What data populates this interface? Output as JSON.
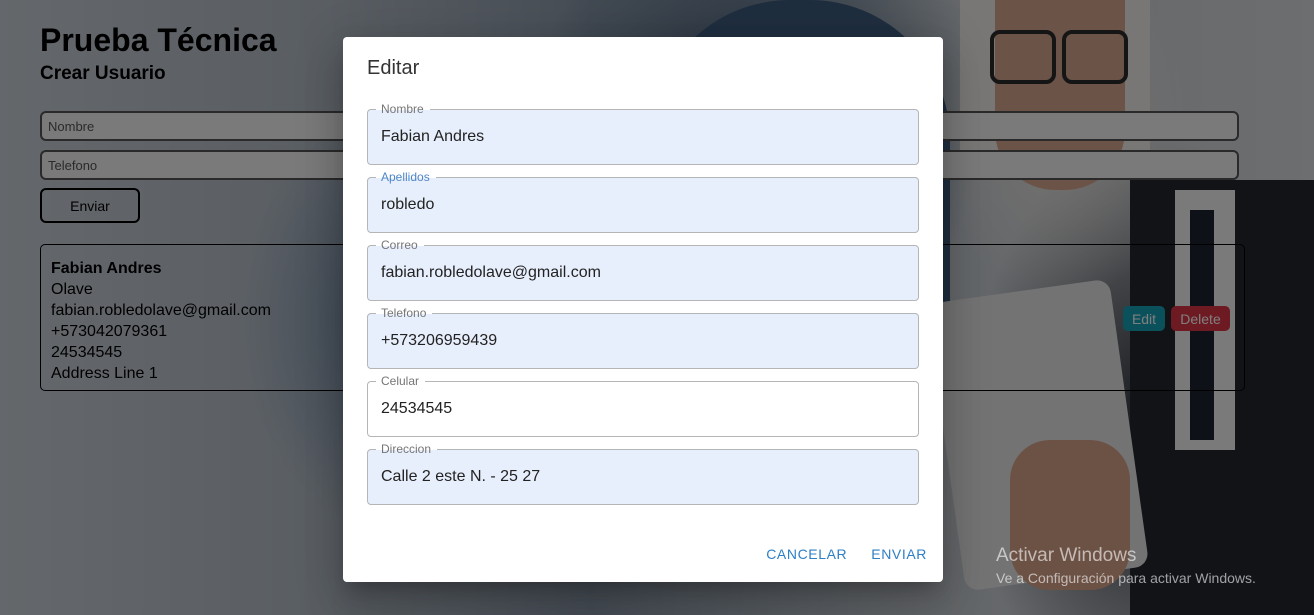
{
  "page": {
    "title": "Prueba Técnica",
    "subtitle": "Crear Usuario",
    "form": {
      "nombre_placeholder": "Nombre",
      "telefono_placeholder": "Telefono",
      "submit_label": "Enviar"
    },
    "user_card": {
      "name": "Fabian Andres",
      "lastname": "Olave",
      "email": "fabian.robledolave@gmail.com",
      "phone": "+573042079361",
      "mobile": "24534545",
      "address": "Address Line 1",
      "edit_label": "Edit",
      "delete_label": "Delete"
    }
  },
  "dialog": {
    "title": "Editar",
    "fields": {
      "nombre": {
        "label": "Nombre",
        "value": "Fabian Andres"
      },
      "apellidos": {
        "label": "Apellidos",
        "value": "robledo"
      },
      "correo": {
        "label": "Correo",
        "value": "fabian.robledolave@gmail.com"
      },
      "telefono": {
        "label": "Telefono",
        "value": "+573206959439"
      },
      "celular": {
        "label": "Celular",
        "value": "24534545"
      },
      "direccion": {
        "label": "Direccion",
        "value": "Calle 2 este N. - 25 27"
      }
    },
    "cancel_label": "CANCELAR",
    "submit_label": "ENVIAR"
  },
  "os_watermark": {
    "title": "Activar Windows",
    "subtitle": "Ve a Configuración para activar Windows."
  },
  "colors": {
    "edit_button": "#17a2b8",
    "delete_button": "#dc3545",
    "dialog_action": "#2f7fc6",
    "autofill_field": "#e8effc"
  }
}
